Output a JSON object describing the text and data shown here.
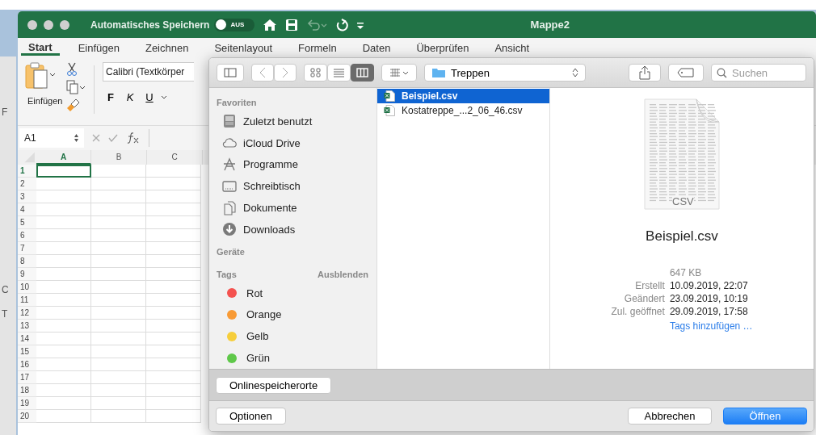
{
  "background_window": {
    "fragments": [
      "F",
      "C",
      "T"
    ]
  },
  "window": {
    "title": "Mappe2",
    "autosave_label": "Automatisches Speichern",
    "autosave": {
      "on": false,
      "label": "AUS"
    }
  },
  "ribbon_tabs": [
    {
      "label": "Start",
      "selected": true
    },
    {
      "label": "Einfügen",
      "selected": false
    },
    {
      "label": "Zeichnen",
      "selected": false
    },
    {
      "label": "Seitenlayout",
      "selected": false
    },
    {
      "label": "Formeln",
      "selected": false
    },
    {
      "label": "Daten",
      "selected": false
    },
    {
      "label": "Überprüfen",
      "selected": false
    },
    {
      "label": "Ansicht",
      "selected": false
    }
  ],
  "ribbon": {
    "paste_label": "Einfügen",
    "font_name": "Calibri (Textkörper",
    "format_buttons": [
      "F",
      "K",
      "U"
    ]
  },
  "formula_bar": {
    "name_box": "A1"
  },
  "sheet": {
    "columns": [
      {
        "label": "A",
        "selected": true
      },
      {
        "label": "B",
        "selected": false
      },
      {
        "label": "C",
        "selected": false
      }
    ],
    "rows": [
      {
        "label": "1",
        "selected": true
      },
      {
        "label": "2",
        "selected": false
      },
      {
        "label": "3",
        "selected": false
      },
      {
        "label": "4",
        "selected": false
      },
      {
        "label": "5",
        "selected": false
      },
      {
        "label": "6",
        "selected": false
      },
      {
        "label": "7",
        "selected": false
      },
      {
        "label": "8",
        "selected": false
      },
      {
        "label": "9",
        "selected": false
      },
      {
        "label": "10",
        "selected": false
      },
      {
        "label": "11",
        "selected": false
      },
      {
        "label": "12",
        "selected": false
      },
      {
        "label": "13",
        "selected": false
      },
      {
        "label": "14",
        "selected": false
      },
      {
        "label": "15",
        "selected": false
      },
      {
        "label": "16",
        "selected": false
      },
      {
        "label": "17",
        "selected": false
      },
      {
        "label": "18",
        "selected": false
      },
      {
        "label": "19",
        "selected": false
      },
      {
        "label": "20",
        "selected": false
      }
    ]
  },
  "dialog": {
    "toolbar": {
      "view_modes": [
        {
          "selected": false
        },
        {
          "selected": false
        },
        {
          "selected": true
        }
      ],
      "location": "Treppen",
      "search": {
        "placeholder": "Suchen"
      }
    },
    "sidebar": {
      "favorites_heading": "Favoriten",
      "favorites": [
        {
          "label": "Zuletzt benutzt"
        },
        {
          "label": "iCloud Drive"
        },
        {
          "label": "Programme"
        },
        {
          "label": "Schreibtisch"
        },
        {
          "label": "Dokumente"
        },
        {
          "label": "Downloads"
        }
      ],
      "devices_heading": "Geräte",
      "tags_heading": "Tags",
      "tags_action": "Ausblenden",
      "tags": [
        {
          "label": "Rot",
          "color": "#f4524f"
        },
        {
          "label": "Orange",
          "color": "#f89a35"
        },
        {
          "label": "Gelb",
          "color": "#f6ce3b"
        },
        {
          "label": "Grün",
          "color": "#5fc84a"
        }
      ]
    },
    "files": [
      {
        "name": "Beispiel.csv",
        "selected": true
      },
      {
        "name": "Kostatreppe_...2_06_46.csv",
        "selected": false
      }
    ],
    "preview": {
      "icon_label": "CSV",
      "name": "Beispiel.csv",
      "size": "647 KB",
      "meta": [
        {
          "label": "Erstellt",
          "value": "10.09.2019, 22:07"
        },
        {
          "label": "Geändert",
          "value": "23.09.2019, 10:19"
        },
        {
          "label": "Zul. geöffnet",
          "value": "29.09.2019, 17:58"
        }
      ],
      "link": "Tags hinzufügen …"
    },
    "online_button": "Onlinespeicherorte",
    "options_button": "Optionen",
    "cancel_button": "Abbrechen",
    "open_button": "Öffnen"
  }
}
